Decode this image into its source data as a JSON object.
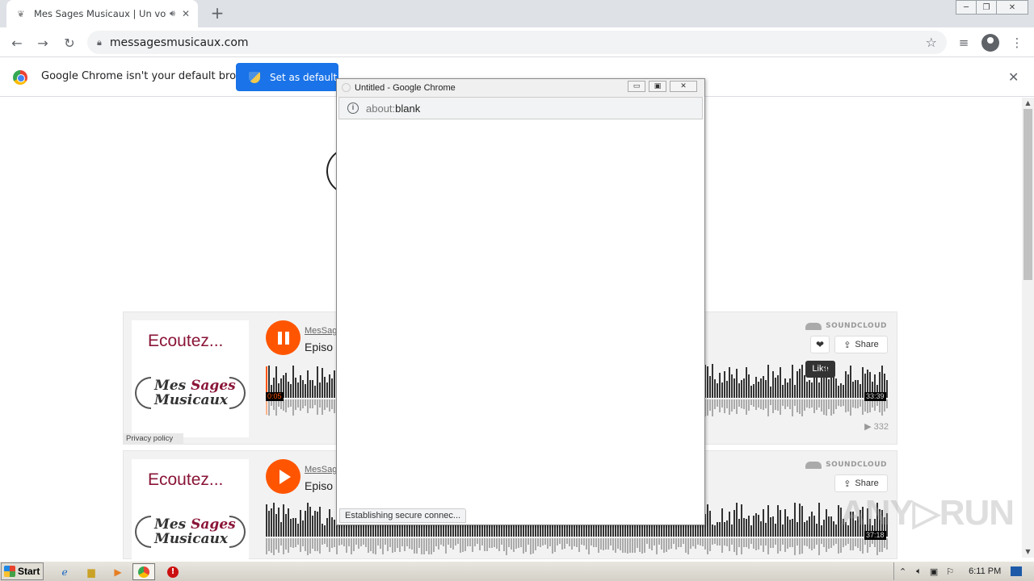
{
  "browser": {
    "tab_title": "Mes Sages Musicaux | Un voyage",
    "new_tab": "+",
    "url": "messagesmusicaux.com",
    "minimize": "─",
    "restore": "❐",
    "close": "✕"
  },
  "infobar": {
    "message": "Google Chrome isn't your default browser",
    "button": "Set as default",
    "close": "✕"
  },
  "players": [
    {
      "artwork_title": "Ecoutez...",
      "artwork_line1": "Mes",
      "artwork_line1b": "Sages",
      "artwork_line2": "Musicaux",
      "artist": "MesSag",
      "title": "Episo",
      "state": "playing",
      "current_time": "0:05",
      "duration": "33:39",
      "plays": "332",
      "progress": 0.003,
      "like_tooltip": "Like",
      "share": "Share",
      "brand": "SOUNDCLOUD"
    },
    {
      "artwork_title": "Ecoutez...",
      "artwork_line1": "Mes",
      "artwork_line1b": "Sages",
      "artwork_line2": "Musicaux",
      "artist": "MesSag",
      "title": "Episo",
      "state": "paused",
      "duration": "37:18",
      "share": "Share",
      "brand": "SOUNDCLOUD"
    }
  ],
  "privacy": "Privacy policy",
  "popup": {
    "title": "Untitled - Google Chrome",
    "url_prefix": "about:",
    "url_rest": "blank",
    "status": "Establishing secure connec..."
  },
  "watermark": "ANY▷RUN",
  "taskbar": {
    "start": "Start",
    "clock": "6:11 PM"
  },
  "colors": {
    "soundcloud_orange": "#ff5500",
    "chrome_blue": "#1a73e8",
    "brand_maroon": "#8a1538"
  }
}
